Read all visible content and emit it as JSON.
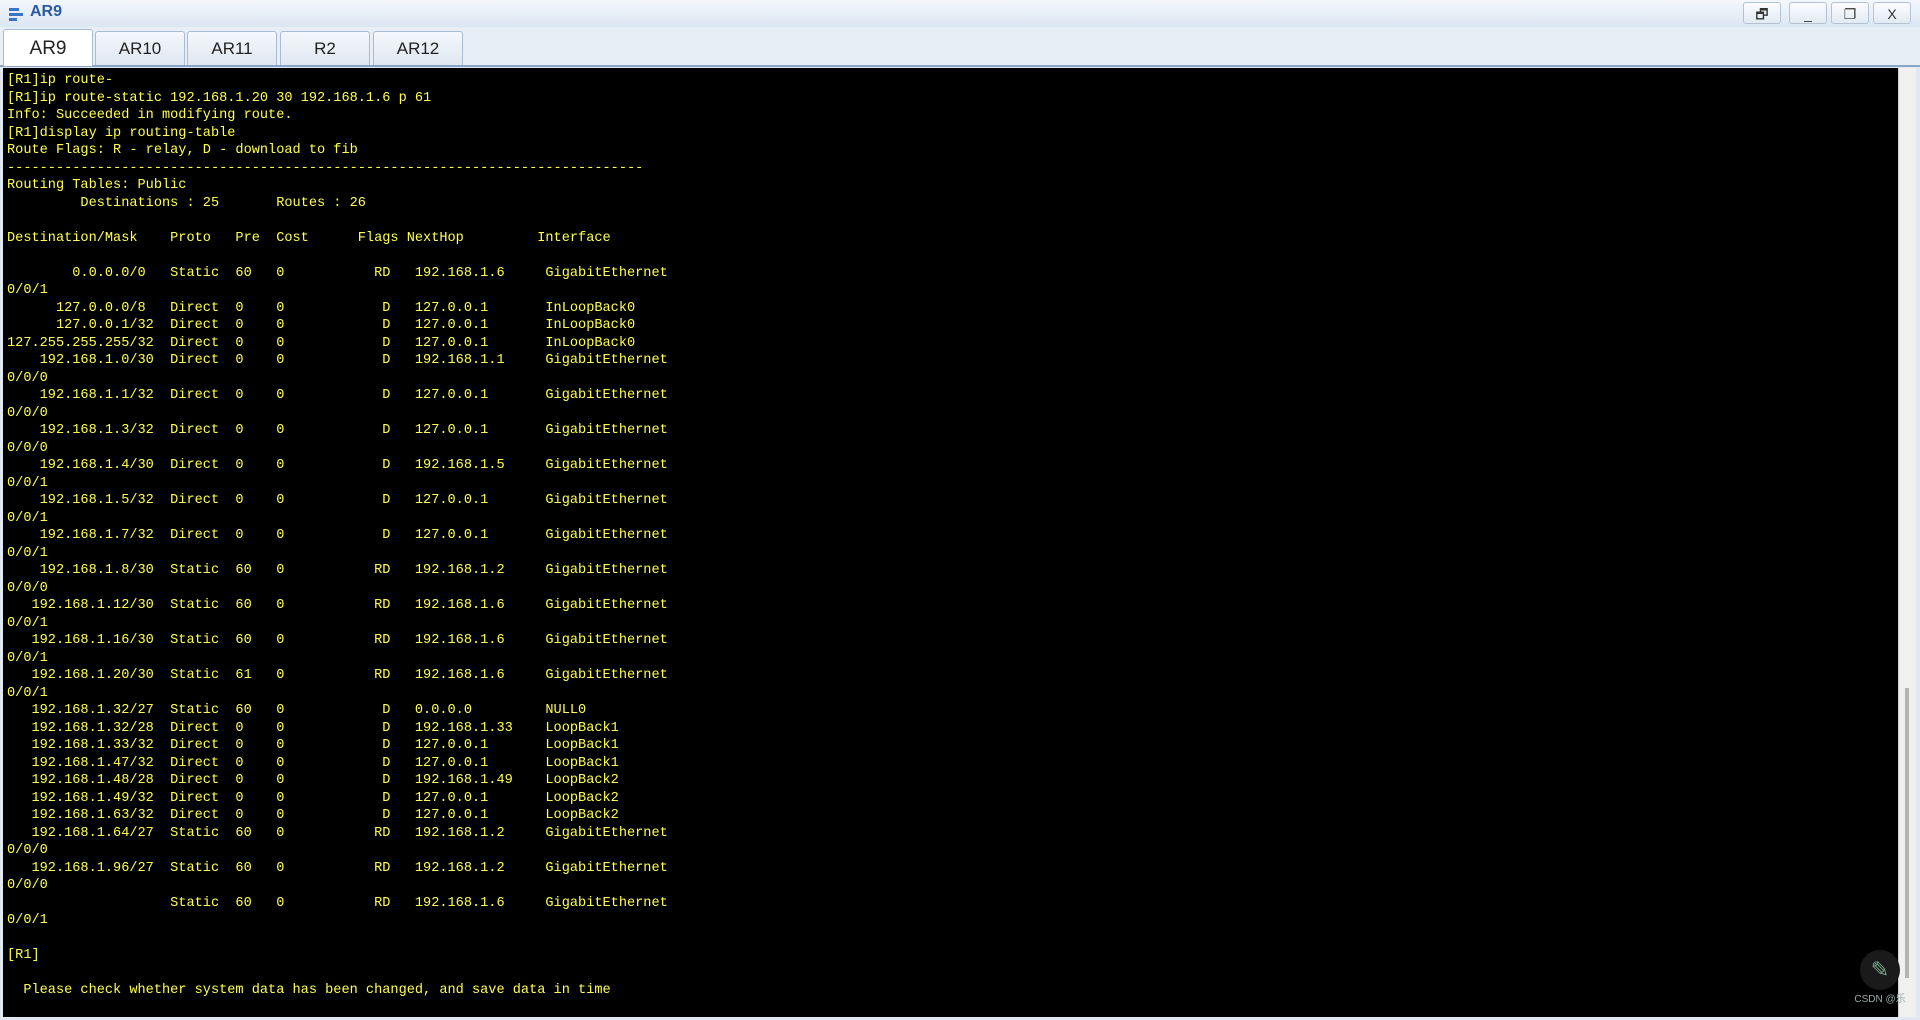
{
  "window": {
    "title": "AR9",
    "restore_label": "🗗",
    "minimize_label": "_",
    "maximize_label": "❐",
    "close_label": "X"
  },
  "tabs": [
    {
      "label": "AR9",
      "active": true
    },
    {
      "label": "AR10"
    },
    {
      "label": "AR11"
    },
    {
      "label": "R2"
    },
    {
      "label": "AR12"
    }
  ],
  "terminal": {
    "lines": [
      "[R1]ip route-",
      "[R1]ip route-static 192.168.1.20 30 192.168.1.6 p 61",
      "Info: Succeeded in modifying route.",
      "[R1]display ip routing-table",
      "Route Flags: R - relay, D - download to fib",
      "------------------------------------------------------------------------------",
      "Routing Tables: Public",
      "         Destinations : 25       Routes : 26",
      "",
      "Destination/Mask    Proto   Pre  Cost      Flags NextHop         Interface",
      "",
      "        0.0.0.0/0   Static  60   0           RD   192.168.1.6     GigabitEthernet",
      "0/0/1",
      "      127.0.0.0/8   Direct  0    0            D   127.0.0.1       InLoopBack0",
      "      127.0.0.1/32  Direct  0    0            D   127.0.0.1       InLoopBack0",
      "127.255.255.255/32  Direct  0    0            D   127.0.0.1       InLoopBack0",
      "    192.168.1.0/30  Direct  0    0            D   192.168.1.1     GigabitEthernet",
      "0/0/0",
      "    192.168.1.1/32  Direct  0    0            D   127.0.0.1       GigabitEthernet",
      "0/0/0",
      "    192.168.1.3/32  Direct  0    0            D   127.0.0.1       GigabitEthernet",
      "0/0/0",
      "    192.168.1.4/30  Direct  0    0            D   192.168.1.5     GigabitEthernet",
      "0/0/1",
      "    192.168.1.5/32  Direct  0    0            D   127.0.0.1       GigabitEthernet",
      "0/0/1",
      "    192.168.1.7/32  Direct  0    0            D   127.0.0.1       GigabitEthernet",
      "0/0/1",
      "    192.168.1.8/30  Static  60   0           RD   192.168.1.2     GigabitEthernet",
      "0/0/0",
      "   192.168.1.12/30  Static  60   0           RD   192.168.1.6     GigabitEthernet",
      "0/0/1",
      "   192.168.1.16/30  Static  60   0           RD   192.168.1.6     GigabitEthernet",
      "0/0/1",
      "   192.168.1.20/30  Static  61   0           RD   192.168.1.6     GigabitEthernet",
      "0/0/1",
      "   192.168.1.32/27  Static  60   0            D   0.0.0.0         NULL0",
      "   192.168.1.32/28  Direct  0    0            D   192.168.1.33    LoopBack1",
      "   192.168.1.33/32  Direct  0    0            D   127.0.0.1       LoopBack1",
      "   192.168.1.47/32  Direct  0    0            D   127.0.0.1       LoopBack1",
      "   192.168.1.48/28  Direct  0    0            D   192.168.1.49    LoopBack2",
      "   192.168.1.49/32  Direct  0    0            D   127.0.0.1       LoopBack2",
      "   192.168.1.63/32  Direct  0    0            D   127.0.0.1       LoopBack2",
      "   192.168.1.64/27  Static  60   0           RD   192.168.1.2     GigabitEthernet",
      "0/0/0",
      "   192.168.1.96/27  Static  60   0           RD   192.168.1.2     GigabitEthernet",
      "0/0/0",
      "                    Static  60   0           RD   192.168.1.6     GigabitEthernet",
      "0/0/1",
      "",
      "[R1]",
      "",
      "  Please check whether system data has been changed, and save data in time"
    ]
  },
  "watermark": {
    "text": "CSDN @乐"
  }
}
